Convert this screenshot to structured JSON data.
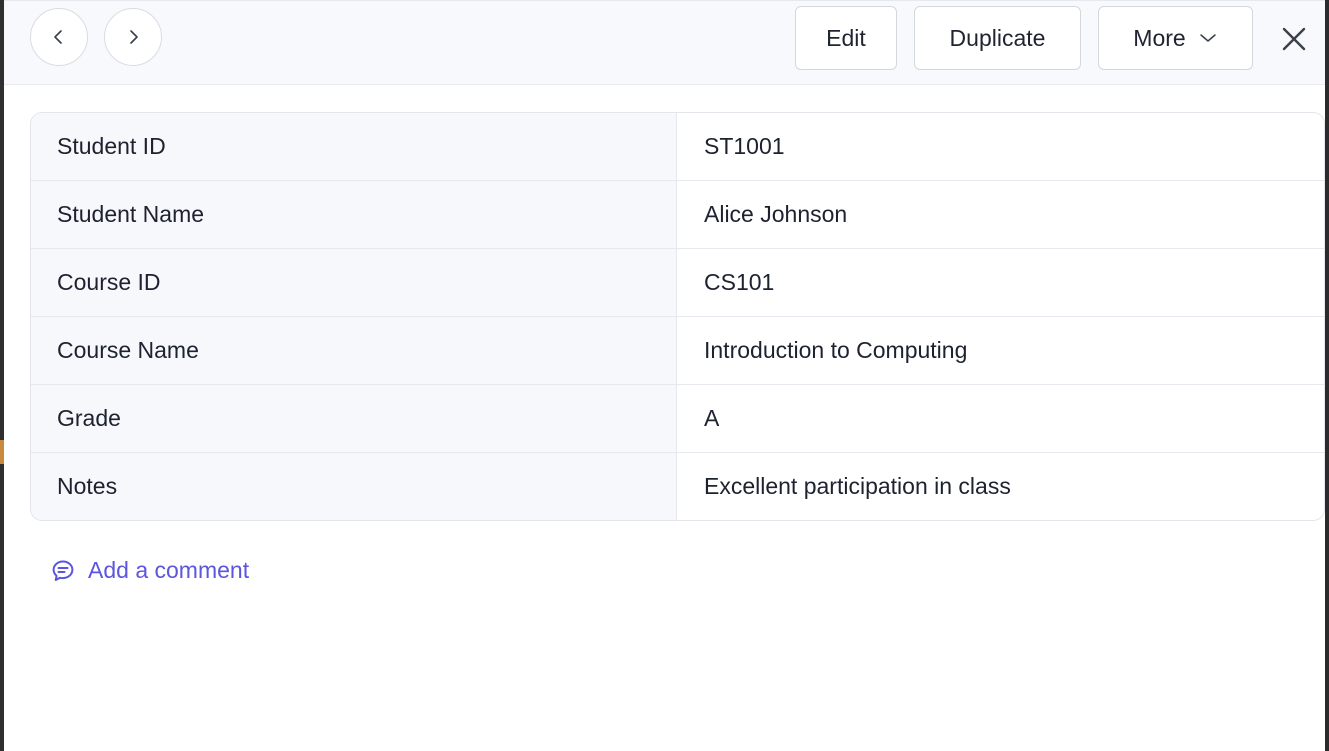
{
  "toolbar": {
    "prev_icon": "chevron-left-icon",
    "next_icon": "chevron-right-icon",
    "edit_label": "Edit",
    "duplicate_label": "Duplicate",
    "more_label": "More",
    "more_icon": "chevron-down-icon",
    "close_icon": "close-icon"
  },
  "record": {
    "fields": [
      {
        "label": "Student ID",
        "value": "ST1001"
      },
      {
        "label": "Student Name",
        "value": "Alice Johnson"
      },
      {
        "label": "Course ID",
        "value": "CS101"
      },
      {
        "label": "Course Name",
        "value": "Introduction to Computing"
      },
      {
        "label": "Grade",
        "value": "A"
      },
      {
        "label": "Notes",
        "value": "Excellent participation in class"
      }
    ]
  },
  "comments": {
    "add_label": "Add a comment",
    "icon": "comment-icon"
  },
  "colors": {
    "accent": "#5b55e0",
    "text": "#1d2230",
    "label_bg": "#f7f8fb",
    "border": "#e6e8ee"
  }
}
